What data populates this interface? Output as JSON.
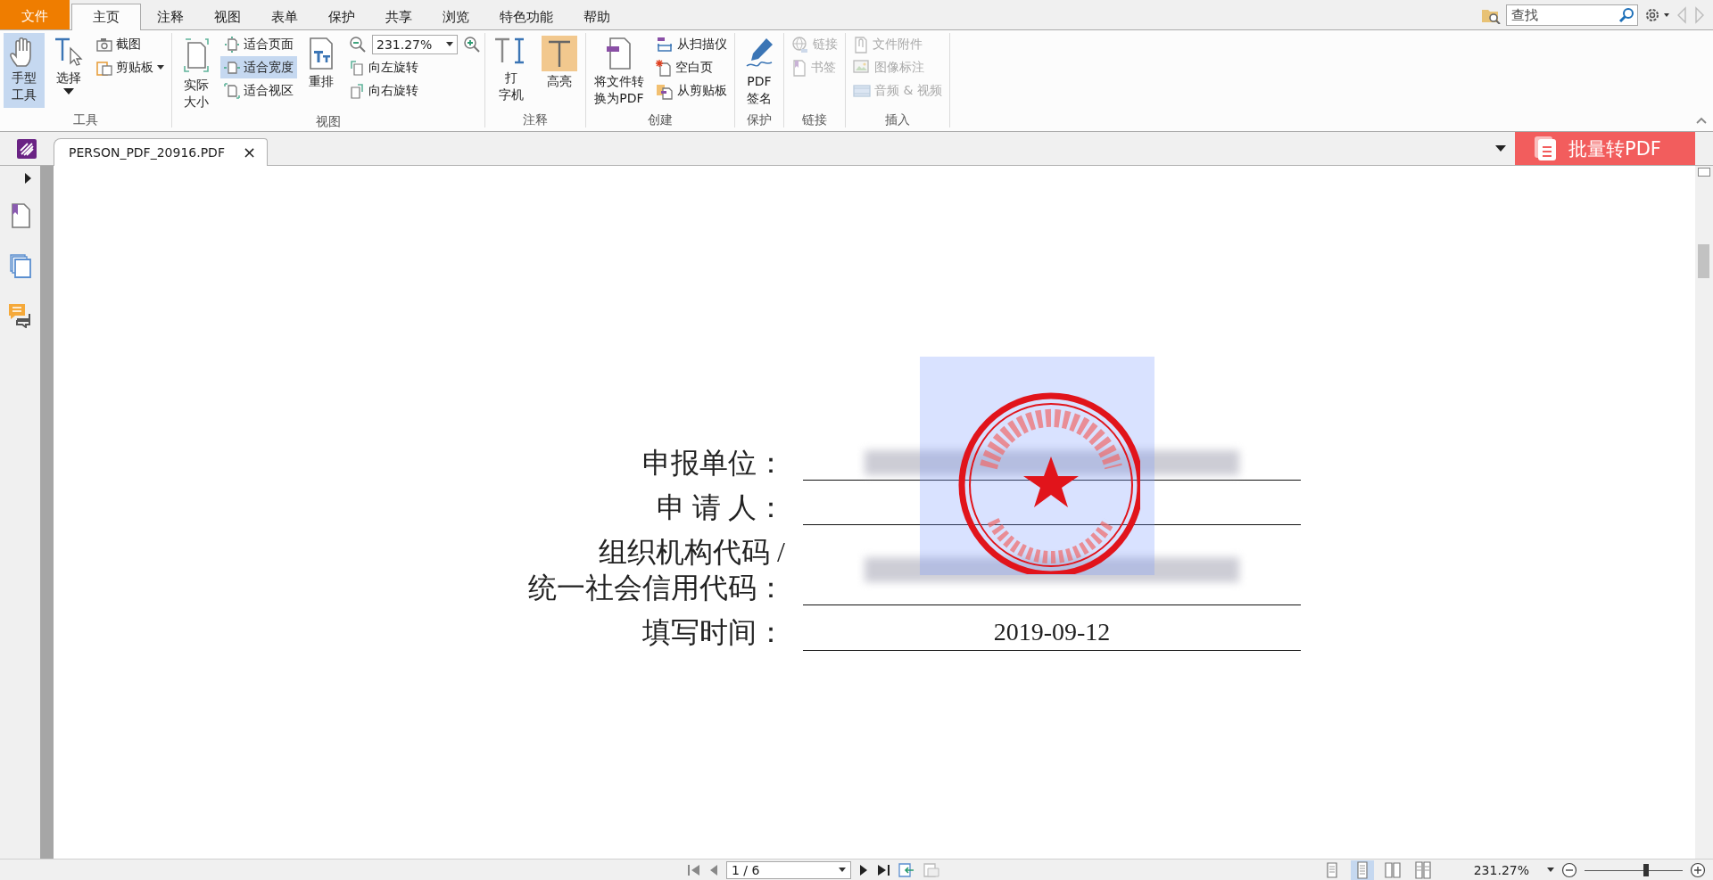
{
  "menu_tabs": [
    {
      "label": "文件",
      "kind": "file",
      "selected": false
    },
    {
      "label": "主页",
      "kind": "tab",
      "selected": true
    },
    {
      "label": "注释",
      "kind": "tab",
      "selected": false
    },
    {
      "label": "视图",
      "kind": "tab",
      "selected": false
    },
    {
      "label": "表单",
      "kind": "tab",
      "selected": false
    },
    {
      "label": "保护",
      "kind": "tab",
      "selected": false
    },
    {
      "label": "共享",
      "kind": "tab",
      "selected": false
    },
    {
      "label": "浏览",
      "kind": "tab",
      "selected": false
    },
    {
      "label": "特色功能",
      "kind": "tab",
      "selected": false
    },
    {
      "label": "帮助",
      "kind": "tab",
      "selected": false
    }
  ],
  "search": {
    "placeholder": "查找"
  },
  "ribbon": {
    "groups": [
      {
        "label": "工具",
        "columns": [
          [
            {
              "kind": "large",
              "label_lines": [
                "手型",
                "工具"
              ],
              "selected": true,
              "disabled": false,
              "dropdown": false
            }
          ],
          [
            {
              "kind": "large",
              "label_lines": [
                "选择"
              ],
              "selected": false,
              "disabled": false,
              "dropdown": true
            }
          ],
          [
            {
              "kind": "small",
              "label": "截图",
              "selected": false,
              "disabled": false,
              "dropdown": false
            },
            {
              "kind": "small",
              "label": "剪贴板",
              "selected": false,
              "disabled": false,
              "dropdown": true
            }
          ]
        ]
      },
      {
        "label": "视图",
        "columns": [
          [
            {
              "kind": "large",
              "label_lines": [
                "实际",
                "大小"
              ],
              "selected": false,
              "disabled": false,
              "dropdown": false
            }
          ],
          [
            {
              "kind": "small",
              "label": "适合页面",
              "selected": false,
              "disabled": false,
              "dropdown": false
            },
            {
              "kind": "small",
              "label": "适合宽度",
              "selected": true,
              "disabled": false,
              "dropdown": false
            },
            {
              "kind": "small",
              "label": "适合视区",
              "selected": false,
              "disabled": false,
              "dropdown": false
            }
          ],
          [
            {
              "kind": "large",
              "label_lines": [
                "重排"
              ],
              "selected": false,
              "disabled": false,
              "dropdown": false
            }
          ],
          [
            {
              "kind": "zoom",
              "value": "231.27%"
            },
            {
              "kind": "small",
              "label": "向左旋转",
              "selected": false,
              "disabled": false,
              "dropdown": false
            },
            {
              "kind": "small",
              "label": "向右旋转",
              "selected": false,
              "disabled": false,
              "dropdown": false
            }
          ]
        ]
      },
      {
        "label": "注释",
        "columns": [
          [
            {
              "kind": "large",
              "label_lines": [
                "打",
                "字机"
              ],
              "selected": false,
              "disabled": false,
              "dropdown": false
            }
          ],
          [
            {
              "kind": "large",
              "label_lines": [
                "高亮"
              ],
              "selected": false,
              "disabled": false,
              "dropdown": false
            }
          ]
        ]
      },
      {
        "label": "创建",
        "columns": [
          [
            {
              "kind": "large",
              "label_lines": [
                "将文件转",
                "换为PDF"
              ],
              "selected": false,
              "disabled": false,
              "dropdown": false
            }
          ],
          [
            {
              "kind": "small",
              "label": "从扫描仪",
              "selected": false,
              "disabled": false,
              "dropdown": false
            },
            {
              "kind": "small",
              "label": "空白页",
              "selected": false,
              "disabled": false,
              "dropdown": false
            },
            {
              "kind": "small",
              "label": "从剪贴板",
              "selected": false,
              "disabled": false,
              "dropdown": false
            }
          ]
        ]
      },
      {
        "label": "保护",
        "columns": [
          [
            {
              "kind": "large",
              "label_lines": [
                "PDF",
                "签名"
              ],
              "selected": false,
              "disabled": false,
              "dropdown": false
            }
          ]
        ]
      },
      {
        "label": "链接",
        "columns": [
          [
            {
              "kind": "small",
              "label": "链接",
              "selected": false,
              "disabled": true,
              "dropdown": false
            },
            {
              "kind": "small",
              "label": "书签",
              "selected": false,
              "disabled": true,
              "dropdown": false
            }
          ]
        ]
      },
      {
        "label": "插入",
        "columns": [
          [
            {
              "kind": "small",
              "label": "文件附件",
              "selected": false,
              "disabled": true,
              "dropdown": false
            },
            {
              "kind": "small",
              "label": "图像标注",
              "selected": false,
              "disabled": true,
              "dropdown": false
            },
            {
              "kind": "small",
              "label": "音频 & 视频",
              "selected": false,
              "disabled": true,
              "dropdown": false
            }
          ]
        ]
      }
    ]
  },
  "document_tabs": [
    {
      "label": "PERSON_PDF_20916.PDF",
      "close": "×",
      "selected": true
    }
  ],
  "promo_button": {
    "label": "批量转PDF"
  },
  "form": {
    "rows": [
      {
        "label": "申报单位：",
        "kind": "redacted"
      },
      {
        "label": "申 请 人：",
        "kind": "blank"
      },
      {
        "label": "组织机构代码 /\n统一社会信用代码：",
        "kind": "redacted"
      },
      {
        "label": "填写时间：",
        "kind": "text",
        "value": "2019-09-12"
      }
    ]
  },
  "status_bar": {
    "page": "1 / 6",
    "view_modes": [
      {
        "selected": false
      },
      {
        "selected": true
      },
      {
        "selected": false
      },
      {
        "selected": false
      }
    ],
    "zoom": "231.27%",
    "zoom_slider": {
      "level": 0.63
    }
  }
}
